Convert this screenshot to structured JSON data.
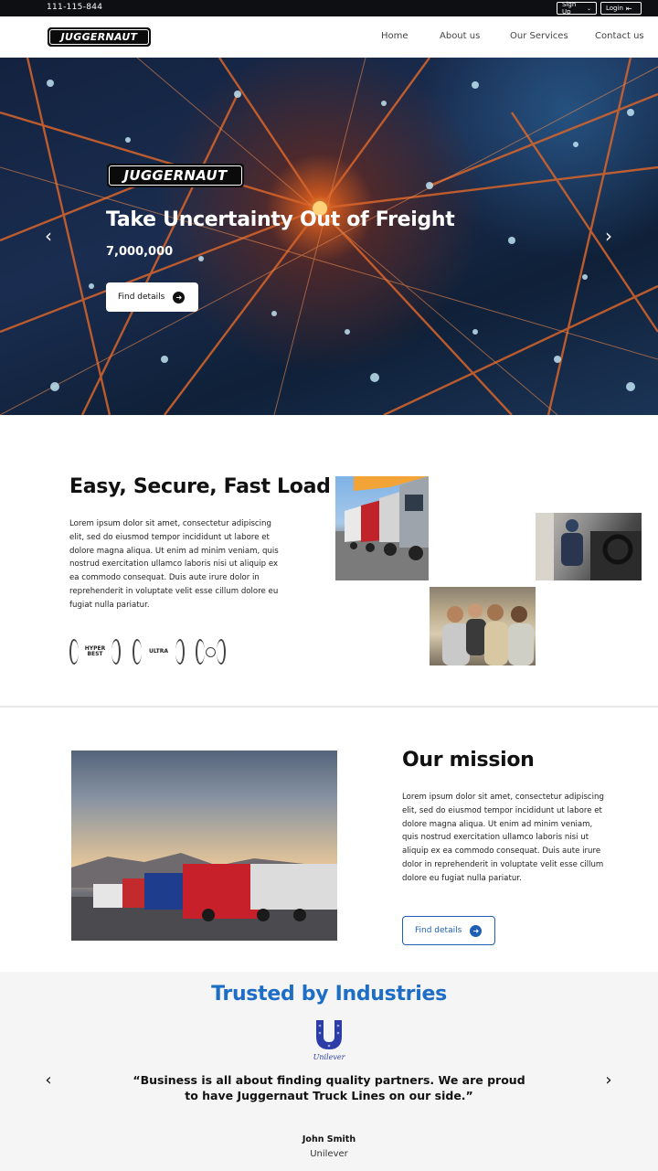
{
  "topbar": {
    "phone": "111-115-844",
    "signup_label": "Sign Up",
    "login_label": "Login"
  },
  "brand": {
    "name": "JUGGERNAUT"
  },
  "nav": {
    "items": [
      {
        "label": "Home"
      },
      {
        "label": "About us"
      },
      {
        "label": "Our Services"
      },
      {
        "label": "Contact us"
      }
    ]
  },
  "hero": {
    "title": "Take Uncertainty Out of Freight",
    "subtitle": "7,000,000",
    "button_label": "Find details"
  },
  "features": {
    "title": "Easy, Secure, Fast Load",
    "paragraph": "Lorem ipsum dolor sit amet, consectetur adipiscing elit, sed do eiusmod tempor incididunt ut labore et dolore magna aliqua. Ut enim ad minim veniam, quis nostrud exercitation ullamco laboris nisi ut aliquip ex ea commodo consequat. Duis aute irure dolor in reprehenderit in voluptate velit esse cillum dolore eu fugiat nulla pariatur.",
    "awards": [
      {
        "line1": "HYPER",
        "line2": "BEST"
      },
      {
        "line1": "ULTRA",
        "line2": ""
      },
      {
        "line1": "",
        "line2": ""
      }
    ]
  },
  "mission": {
    "title": "Our mission",
    "paragraph": "Lorem ipsum dolor sit amet, consectetur adipiscing elit, sed do eiusmod tempor incididunt ut labore et dolore magna aliqua. Ut enim ad minim veniam, quis nostrud exercitation ullamco laboris nisi ut aliquip ex ea commodo consequat. Duis aute irure dolor in reprehenderit in voluptate velit esse cillum dolore eu fugiat nulla pariatur.",
    "button_label": "Find details"
  },
  "trusted": {
    "title": "Trusted by Industries",
    "logo_text": "Unilever",
    "quote": "“Business is all about finding quality partners. We are proud to have Juggernaut Truck Lines on our side.”",
    "author": "John Smith",
    "company": "Unilever"
  },
  "colors": {
    "accent": "#1e6ec6",
    "button_outline": "#1e5fb3",
    "topbar": "#0d0f12"
  },
  "icons": {
    "prev": "chevron-left-icon",
    "next": "chevron-right-icon",
    "arrow": "arrow-right-circle-icon",
    "login": "login-icon",
    "dropdown": "chevron-down-icon"
  }
}
